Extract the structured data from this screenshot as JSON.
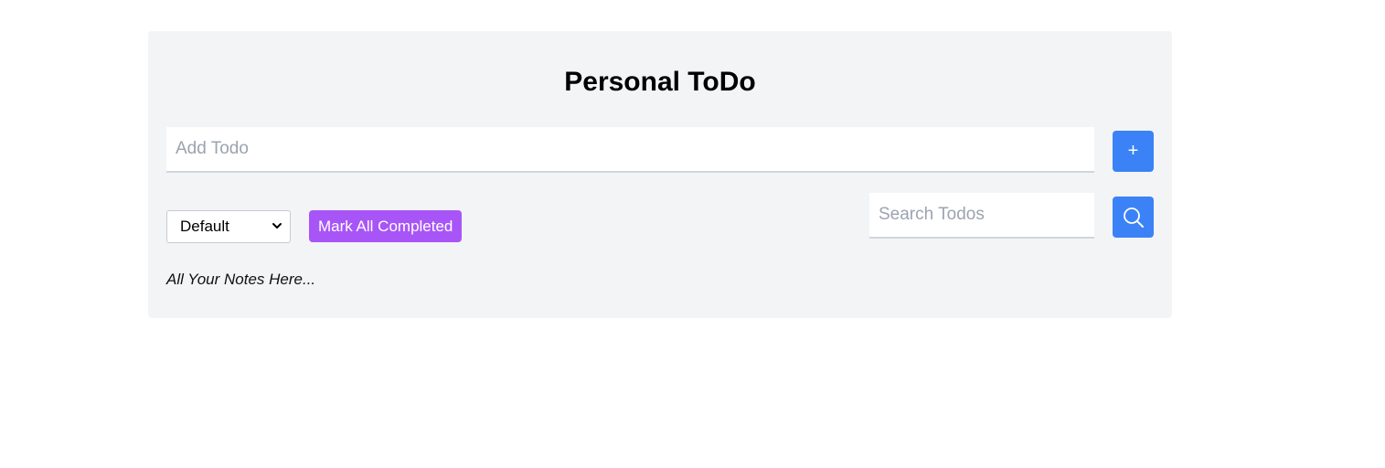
{
  "app": {
    "title": "Personal ToDo"
  },
  "add_todo": {
    "placeholder": "Add Todo",
    "value": "",
    "button_label": "+"
  },
  "filter": {
    "selected": "Default",
    "icon": "chevron-down-icon"
  },
  "actions": {
    "mark_all_label": "Mark All Completed"
  },
  "search": {
    "placeholder": "Search Todos",
    "value": "",
    "icon": "search-icon"
  },
  "notes": {
    "empty_text": "All Your Notes Here..."
  },
  "colors": {
    "card_background": "#f3f4f6",
    "primary_button": "#3b82f6",
    "mark_all_button": "#a855f7"
  }
}
